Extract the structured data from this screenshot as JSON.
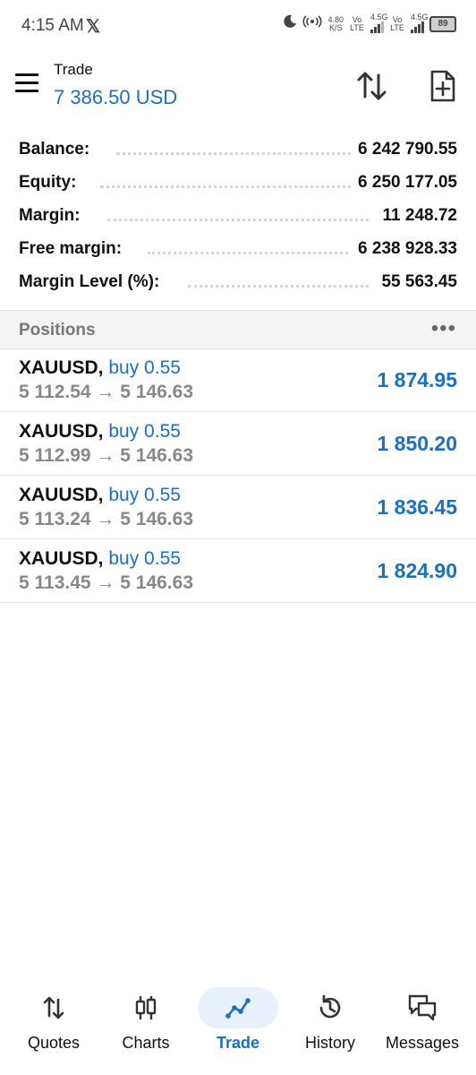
{
  "status_bar": {
    "time": "4:15 AM",
    "x_logo": "𝕏",
    "net_speed_value": "4.80",
    "net_speed_unit": "K/S",
    "sim1_label": "Vo LTE",
    "sim1_net": "4.5G",
    "sim2_label": "Vo LTE",
    "sim2_net": "4.5G",
    "battery": "89"
  },
  "header": {
    "title": "Trade",
    "subtitle": "7 386.50 USD"
  },
  "summary": [
    {
      "label": "Balance:",
      "value": "6 242 790.55"
    },
    {
      "label": "Equity:",
      "value": "6 250 177.05"
    },
    {
      "label": "Margin:",
      "value": "11 248.72"
    },
    {
      "label": "Free margin:",
      "value": "6 238 928.33"
    },
    {
      "label": "Margin Level (%):",
      "value": "55 563.45"
    }
  ],
  "positions_header": {
    "title": "Positions",
    "more": "•••"
  },
  "positions": [
    {
      "symbol": "XAUUSD,",
      "side": "buy 0.55",
      "prices": "5 112.54 → 5 146.63",
      "profit": "1 874.95"
    },
    {
      "symbol": "XAUUSD,",
      "side": "buy 0.55",
      "prices": "5 112.99 → 5 146.63",
      "profit": "1 850.20"
    },
    {
      "symbol": "XAUUSD,",
      "side": "buy 0.55",
      "prices": "5 113.24 → 5 146.63",
      "profit": "1 836.45"
    },
    {
      "symbol": "XAUUSD,",
      "side": "buy 0.55",
      "prices": "5 113.45 → 5 146.63",
      "profit": "1 824.90"
    }
  ],
  "nav": {
    "quotes": "Quotes",
    "charts": "Charts",
    "trade": "Trade",
    "history": "History",
    "messages": "Messages",
    "active": "trade"
  },
  "colors": {
    "accent": "#1a6fc9",
    "muted": "#888888",
    "active_bg": "#e8f1fb"
  }
}
